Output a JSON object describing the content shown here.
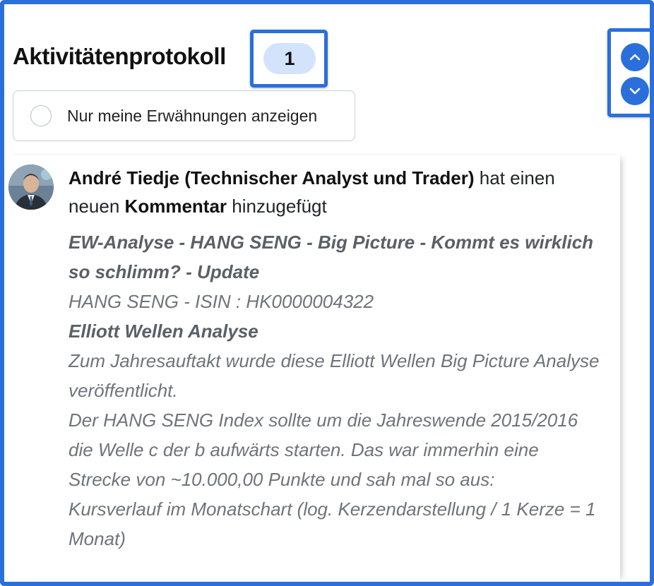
{
  "header": {
    "title": "Aktivitätenprotokoll",
    "count": "1"
  },
  "nav": {
    "up_icon": "chevron-up-icon",
    "down_icon": "chevron-down-icon"
  },
  "filter": {
    "label": "Nur meine Erwähnungen anzeigen",
    "checked": false
  },
  "activity": {
    "author": "André Tiedje (Technischer Analyst und Trader)",
    "action_prefix": "hat einen neuen",
    "action_object": "Kommentar",
    "action_suffix": "hinzugefügt",
    "lines": [
      {
        "text": "EW-Analyse - HANG SENG - Big Picture - Kommt es wirklich so schlimm? - Update",
        "strong": true
      },
      {
        "text": "HANG SENG - ISIN : HK0000004322",
        "strong": false
      },
      {
        "text": "Elliott Wellen Analyse",
        "strong": true
      },
      {
        "text": "Zum Jahresauftakt wurde diese Elliott Wellen Big Picture Analyse veröffentlicht.",
        "strong": false
      },
      {
        "text": "Der HANG SENG Index sollte um die Jahreswende 2015/2016 die Welle c der b aufwärts starten. Das war immerhin eine Strecke von ~10.000,00 Punkte und sah mal so aus:",
        "strong": false
      },
      {
        "text": "Kursverlauf im Monatschart (log. Kerzendarstellung / 1 Kerze = 1 Monat)",
        "strong": false
      }
    ]
  },
  "colors": {
    "accent": "#2a6fdb",
    "badge_bg": "#d3e3fb",
    "muted_text": "#6e747b"
  }
}
